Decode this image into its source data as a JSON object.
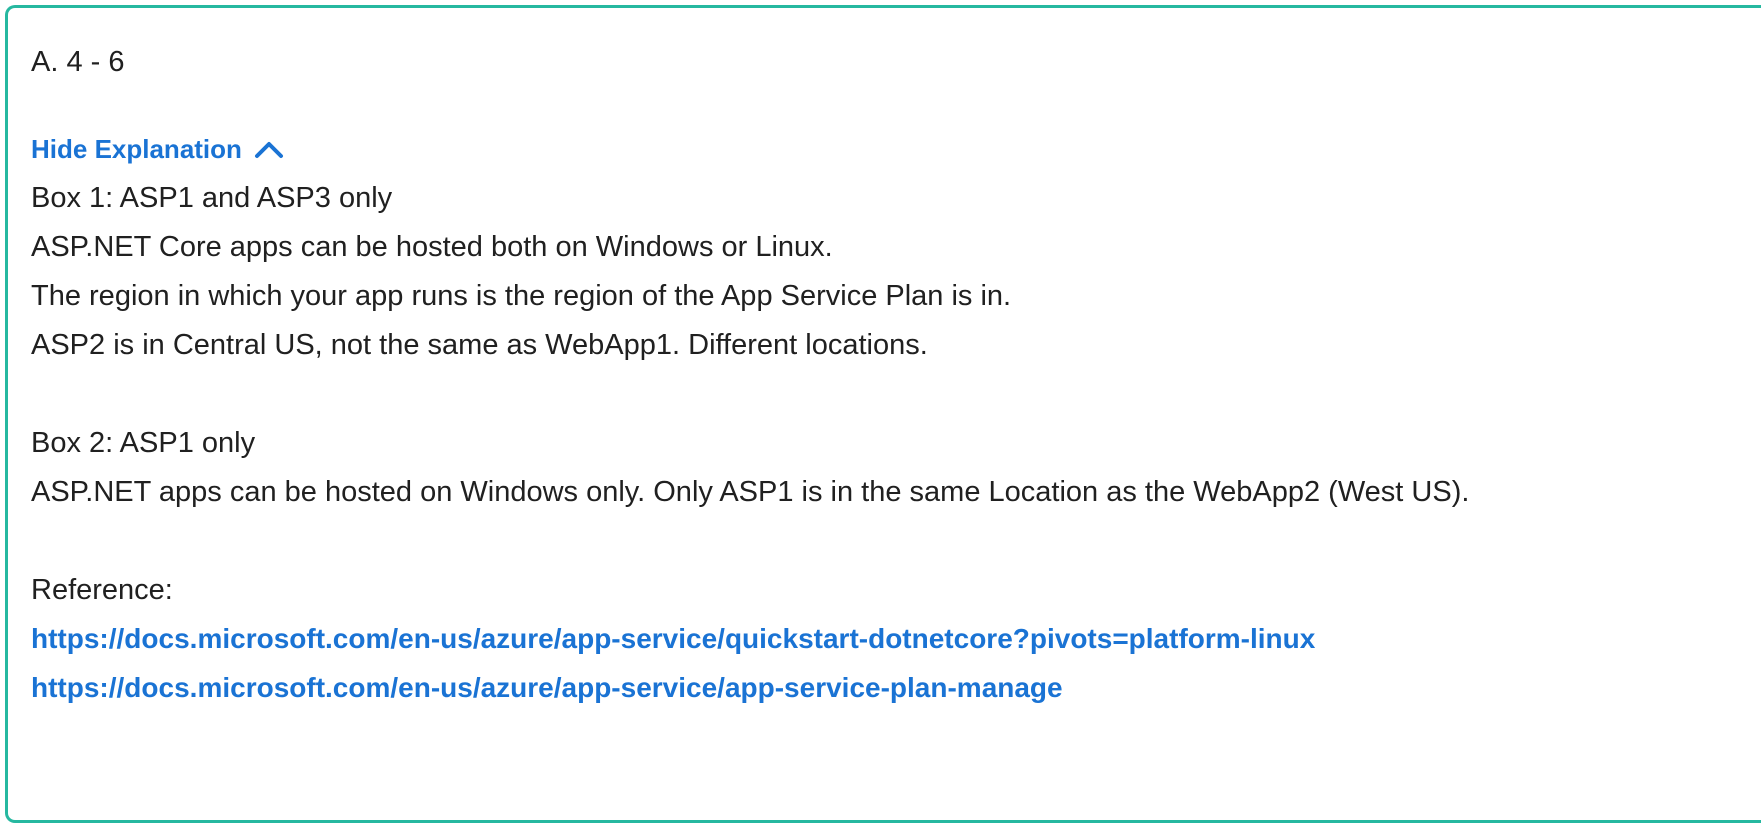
{
  "answer": {
    "label": "A. 4 - 6"
  },
  "toggle": {
    "label": "Hide Explanation",
    "icon": "chevron-up-icon",
    "color": "#1a73d4"
  },
  "explanation": {
    "box1": {
      "heading": "Box 1: ASP1 and ASP3 only",
      "lines": [
        "ASP.NET Core apps can be hosted both on Windows or Linux.",
        "The region in which your app runs is the region of the App Service Plan is in.",
        "ASP2 is in Central US, not the same as WebApp1. Different locations."
      ]
    },
    "box2": {
      "heading": "Box 2: ASP1 only",
      "lines": [
        "ASP.NET apps can be hosted on Windows only. Only ASP1 is in the same Location as the WebApp2 (West US)."
      ]
    },
    "reference": {
      "label": "Reference:",
      "links": [
        "https://docs.microsoft.com/en-us/azure/app-service/quickstart-dotnetcore?pivots=platform-linux",
        "https://docs.microsoft.com/en-us/azure/app-service/app-service-plan-manage"
      ]
    }
  },
  "colors": {
    "border": "#26b8a0",
    "text": "#202020",
    "link": "#1a73d4"
  }
}
